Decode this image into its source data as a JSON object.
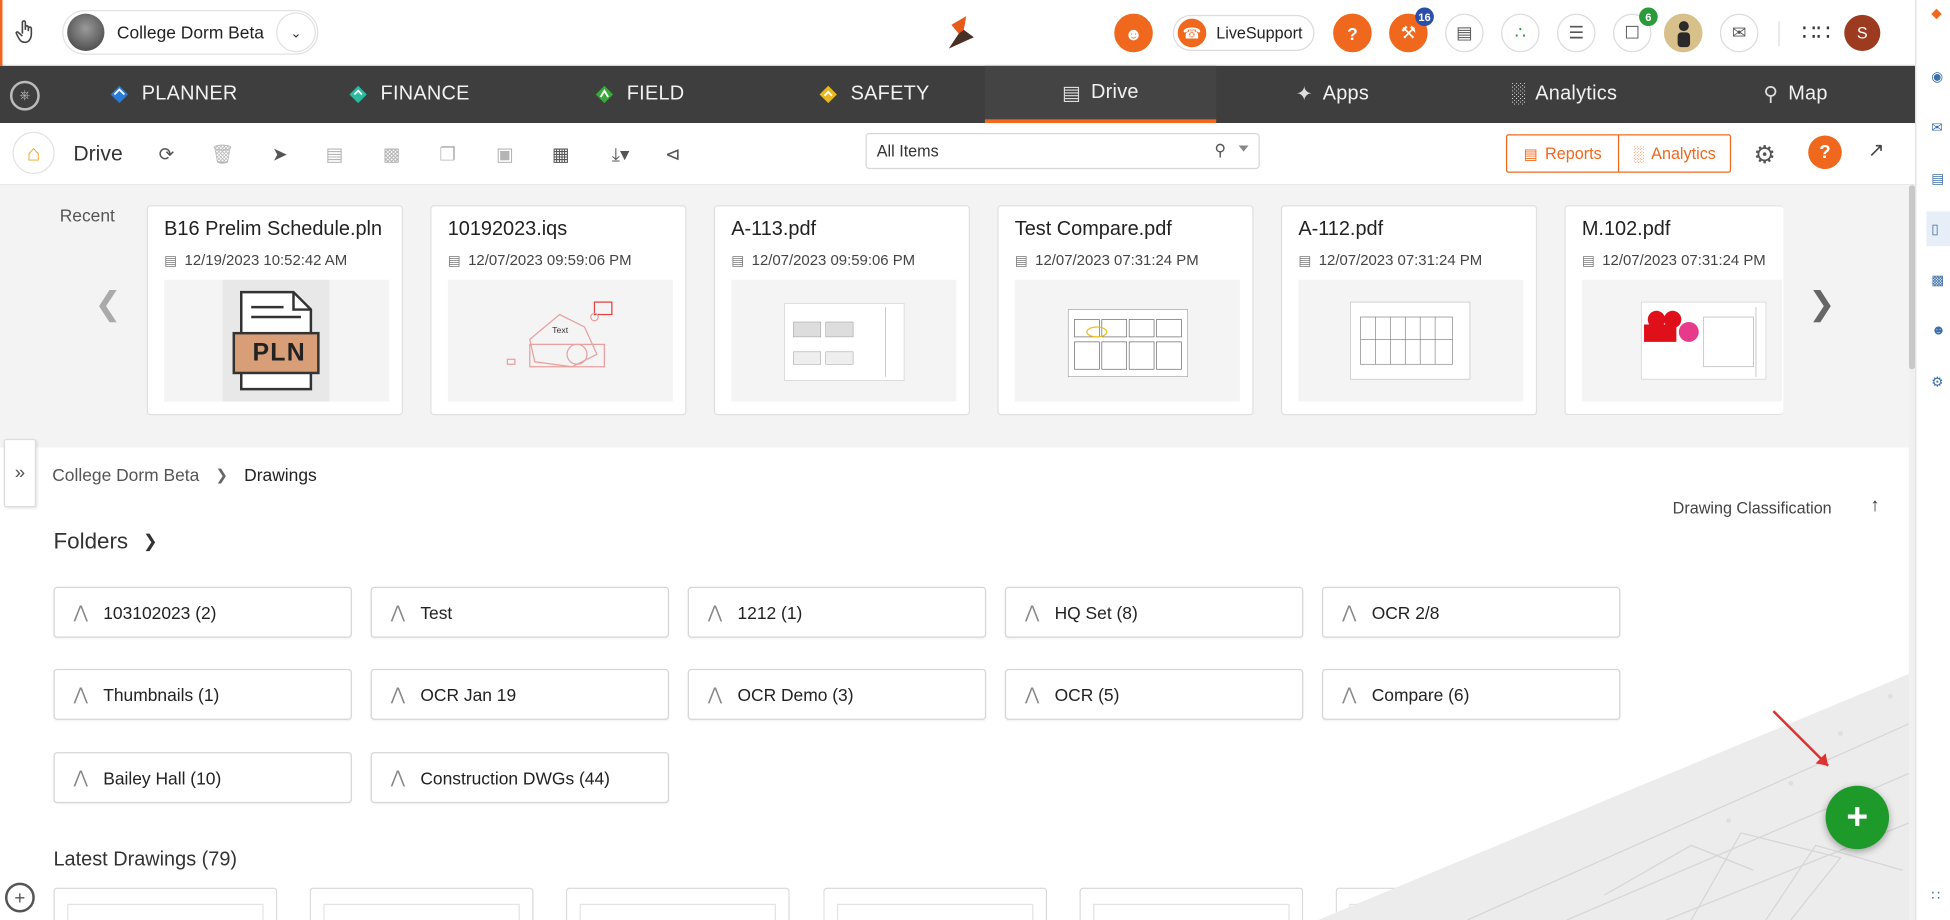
{
  "topbar": {
    "project_name": "College Dorm Beta",
    "live_support": "LiveSupport",
    "notif_badge": "16",
    "cart_badge": "6",
    "user_initial": "S"
  },
  "nav": {
    "items": [
      {
        "label": "PLANNER"
      },
      {
        "label": "FINANCE"
      },
      {
        "label": "FIELD"
      },
      {
        "label": "SAFETY"
      },
      {
        "label": "Drive"
      },
      {
        "label": "Apps"
      },
      {
        "label": "Analytics"
      },
      {
        "label": "Map"
      }
    ],
    "active": "Drive"
  },
  "toolbar": {
    "title": "Drive",
    "search_value": "All Items",
    "reports_label": "Reports",
    "analytics_label": "Analytics"
  },
  "recent": {
    "label": "Recent",
    "cards": [
      {
        "title": "B16 Prelim Schedule.pln",
        "date": "12/19/2023 10:52:42 AM"
      },
      {
        "title": "10192023.iqs",
        "date": "12/07/2023 09:59:06 PM"
      },
      {
        "title": "A-113.pdf",
        "date": "12/07/2023 09:59:06 PM"
      },
      {
        "title": "Test Compare.pdf",
        "date": "12/07/2023 07:31:24 PM"
      },
      {
        "title": "A-112.pdf",
        "date": "12/07/2023 07:31:24 PM"
      },
      {
        "title": "M.102.pdf",
        "date": "12/07/2023 07:31:24 PM"
      }
    ],
    "pln_label": "PLN",
    "iqs_text": "Text"
  },
  "breadcrumb": {
    "root": "College Dorm Beta",
    "current": "Drawings"
  },
  "sort": {
    "label": "Drawing Classification"
  },
  "folders": {
    "title": "Folders",
    "items": [
      {
        "label": "103102023 (2)"
      },
      {
        "label": "Test"
      },
      {
        "label": "1212 (1)"
      },
      {
        "label": "HQ Set (8)"
      },
      {
        "label": "OCR 2/8"
      },
      {
        "label": "Thumbnails (1)"
      },
      {
        "label": "OCR Jan 19"
      },
      {
        "label": "OCR Demo (3)"
      },
      {
        "label": "OCR (5)"
      },
      {
        "label": "Compare (6)"
      },
      {
        "label": "Bailey Hall (10)"
      },
      {
        "label": "Construction DWGs (44)"
      }
    ]
  },
  "latest": {
    "title": "Latest Drawings (79)"
  },
  "colors": {
    "accent": "#f0681e",
    "nav_bg": "#3e3e3e",
    "fab": "#1d9a2a"
  }
}
